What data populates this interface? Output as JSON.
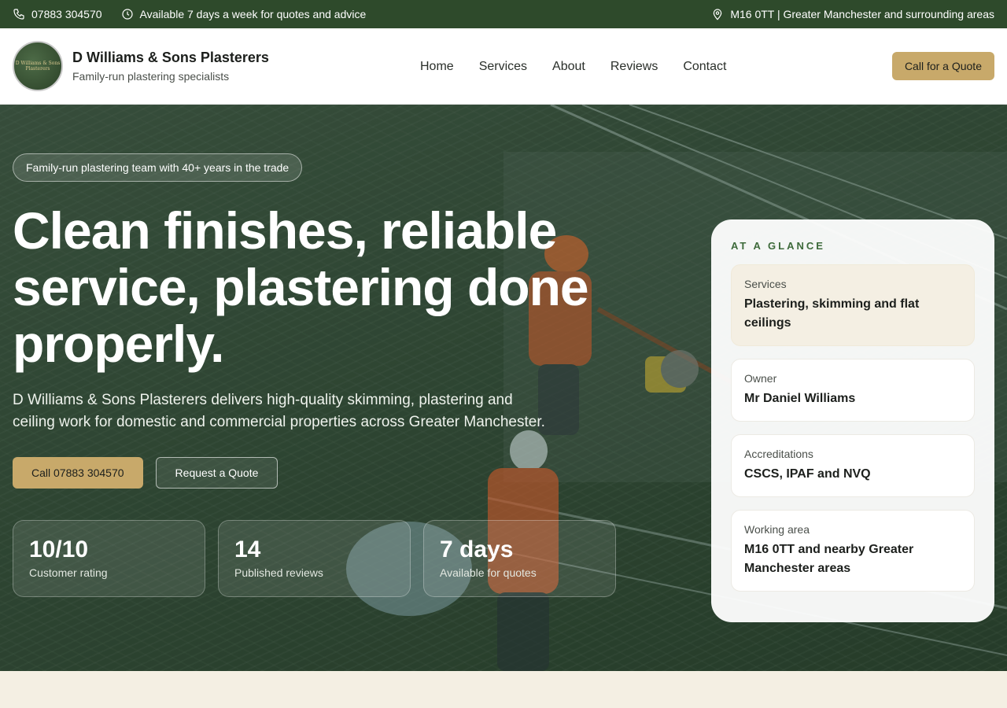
{
  "topbar": {
    "phone": "07883 304570",
    "availability": "Available 7 days a week for quotes and advice",
    "location": "M16 0TT | Greater Manchester and surrounding areas"
  },
  "header": {
    "logo_text": "D Williams & Sons Plasterers",
    "brand_name": "D Williams & Sons Plasterers",
    "tagline": "Family-run plastering specialists",
    "nav": [
      "Home",
      "Services",
      "About",
      "Reviews",
      "Contact"
    ],
    "cta": "Call for a Quote"
  },
  "hero": {
    "badge": "Family-run plastering team with 40+ years in the trade",
    "title": "Clean finishes, reliable service, plastering done properly.",
    "subtitle": "D Williams & Sons Plasterers delivers high-quality skimming, plastering and ceiling work for domestic and commercial properties across Greater Manchester.",
    "primary_button": "Call 07883 304570",
    "secondary_button": "Request a Quote",
    "stats": [
      {
        "value": "10/10",
        "label": "Customer rating"
      },
      {
        "value": "14",
        "label": "Published reviews"
      },
      {
        "value": "7 days",
        "label": "Available for quotes"
      }
    ]
  },
  "glance": {
    "title": "AT A GLANCE",
    "items": [
      {
        "label": "Services",
        "value": "Plastering, skimming and flat ceilings"
      },
      {
        "label": "Owner",
        "value": "Mr Daniel Williams"
      },
      {
        "label": "Accreditations",
        "value": "CSCS, IPAF and NVQ"
      },
      {
        "label": "Working area",
        "value": "M16 0TT and nearby Greater Manchester areas"
      }
    ]
  },
  "colors": {
    "primary_green": "#2e4a2b",
    "accent_gold": "#c8a96a",
    "cream": "#f4efe3"
  }
}
